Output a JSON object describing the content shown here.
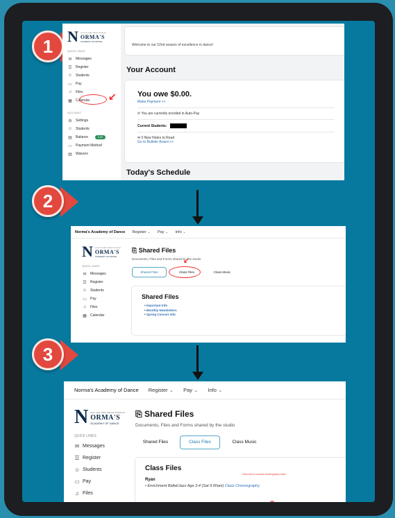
{
  "steps": [
    "1",
    "2",
    "3"
  ],
  "brand": "Norma's Academy of Dance",
  "logo": {
    "big": "N",
    "rest": "ORMA'S",
    "sub": "ACADEMY OF DANCE",
    "tag": "you can take dance lessons"
  },
  "nav_menus": [
    "Register",
    "Pay",
    "Info"
  ],
  "panel1": {
    "quick_links_caption": "QUICK LINKS",
    "quick_links": [
      {
        "icon": "messages-icon",
        "glyph": "✉",
        "label": "Messages"
      },
      {
        "icon": "register-icon",
        "glyph": "☰",
        "label": "Register"
      },
      {
        "icon": "students-icon",
        "glyph": "☺",
        "label": "Students"
      },
      {
        "icon": "pay-icon",
        "glyph": "▭",
        "label": "Pay"
      },
      {
        "icon": "files-icon",
        "glyph": "♫",
        "label": "Files"
      },
      {
        "icon": "calendar-icon",
        "glyph": "▦",
        "label": "Calendar"
      }
    ],
    "account_caption": "ACCOUNT",
    "account_links": [
      {
        "icon": "settings-icon",
        "glyph": "⚙",
        "label": "Settings"
      },
      {
        "icon": "students-icon",
        "glyph": "☺",
        "label": "Students"
      },
      {
        "icon": "balance-icon",
        "glyph": "▤",
        "label": "Balance",
        "badge": "0.00"
      },
      {
        "icon": "payment-icon",
        "glyph": "▭",
        "label": "Payment Method"
      },
      {
        "icon": "waivers-icon",
        "glyph": "▤",
        "label": "Waivers"
      }
    ],
    "welcome": "Welcome to our 52nd season of excellence in dance!",
    "your_account": "Your Account",
    "owe": "You owe $0.00.",
    "make_payment": "Make Payment >>",
    "autopay": "You are currently enrolled in Auto-Pay",
    "current_students": "Current Students:",
    "notes": "0 New Notes to Read",
    "bulletin": "Go to Bulletin Board >>",
    "todays_schedule": "Today's Schedule"
  },
  "panel2": {
    "shared_files_title": "Shared Files",
    "subtitle": "Documents, Files and Forms shared by the studio",
    "tabs": [
      "Shared Files",
      "Class Files",
      "Class Music"
    ],
    "quick_links_caption": "QUICK LINKS",
    "quick_links": [
      {
        "icon": "messages-icon",
        "glyph": "✉",
        "label": "Messages"
      },
      {
        "icon": "register-icon",
        "glyph": "☰",
        "label": "Register"
      },
      {
        "icon": "students-icon",
        "glyph": "☺",
        "label": "Students"
      },
      {
        "icon": "pay-icon",
        "glyph": "▭",
        "label": "Pay"
      },
      {
        "icon": "files-icon",
        "glyph": "♫",
        "label": "Files"
      },
      {
        "icon": "calendar-icon",
        "glyph": "▦",
        "label": "Calendar"
      }
    ],
    "card_title": "Shared Files",
    "items": [
      "Important Info",
      "Monthly Newsletters",
      "Spring Concert Info"
    ]
  },
  "panel3": {
    "shared_files_title": "Shared Files",
    "subtitle": "Documents, Files and Forms shared by the studio",
    "tabs": [
      "Shared Files",
      "Class Files",
      "Class Music"
    ],
    "quick_links_caption": "QUICK LINKS",
    "quick_links": [
      {
        "icon": "messages-icon",
        "glyph": "✉",
        "label": "Messages"
      },
      {
        "icon": "register-icon",
        "glyph": "☰",
        "label": "Register"
      },
      {
        "icon": "students-icon",
        "glyph": "☺",
        "label": "Students"
      },
      {
        "icon": "pay-icon",
        "glyph": "▭",
        "label": "Pay"
      },
      {
        "icon": "files-icon",
        "glyph": "♫",
        "label": "Files"
      }
    ],
    "card_title": "Class Files",
    "student": "Ryan",
    "class_line": "Enrichment Ballet/Jazz Age 3-4 (Sat 9:00am)",
    "class_link": "Class Choreography",
    "hint": "Click here to access choreography video"
  },
  "colors": {
    "background": "#07799e",
    "badge": "#e2483e",
    "link": "#2b6db3",
    "selected_tab": "#1d78a8",
    "annotation": "#e33333"
  }
}
